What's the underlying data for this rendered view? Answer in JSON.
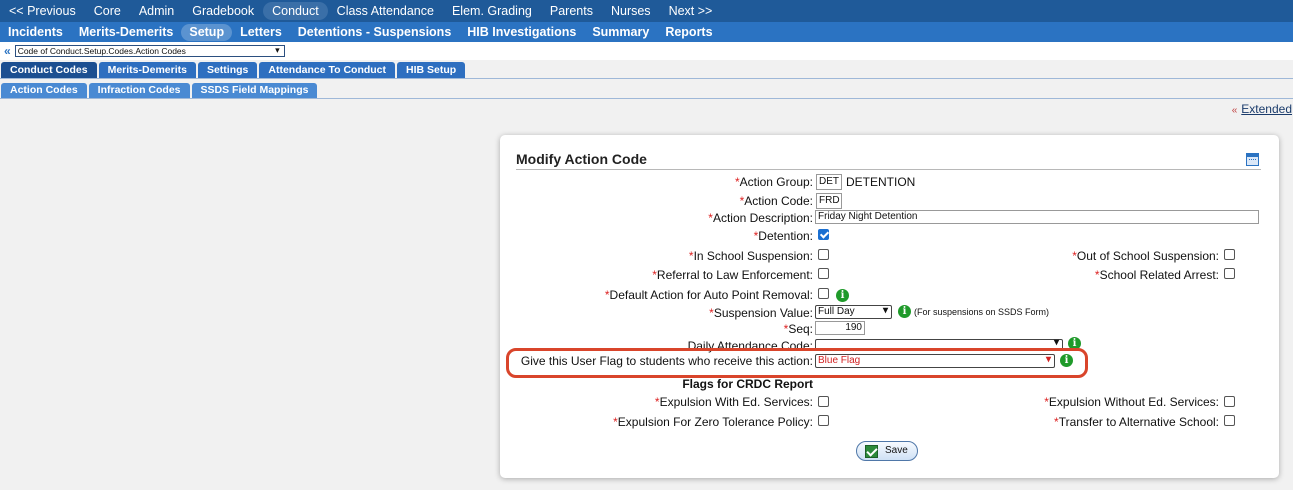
{
  "top_nav": [
    "<< Previous",
    "Core",
    "Admin",
    "Gradebook",
    "Conduct",
    "Class Attendance",
    "Elem. Grading",
    "Parents",
    "Nurses",
    "Next >>"
  ],
  "sub_nav": [
    "Incidents",
    "Merits-Demerits",
    "Setup",
    "Letters",
    "Detentions - Suspensions",
    "HIB Investigations",
    "Summary",
    "Reports"
  ],
  "crumb": {
    "chevron": "«",
    "path": "Code of Conduct.Setup.Codes.Action Codes"
  },
  "tabs1": [
    "Conduct Codes",
    "Merits-Demerits",
    "Settings",
    "Attendance To Conduct",
    "HIB Setup"
  ],
  "tabs2": [
    "Action Codes",
    "Infraction Codes",
    "SSDS Field Mappings"
  ],
  "extended": {
    "arrow": "«",
    "label": "Extended"
  },
  "form": {
    "title": "Modify Action Code",
    "req": "*",
    "action_group_label": "Action Group:",
    "action_group_code": "DET",
    "action_group_name": "DETENTION",
    "action_code_label": "Action Code:",
    "action_code_value": "FRD",
    "action_description_label": "Action Description:",
    "action_description_value": "Friday Night Detention",
    "detention_label": "Detention:",
    "in_school_label": "In School Suspension:",
    "out_school_label": "Out of School Suspension:",
    "referral_label": "Referral to Law Enforcement:",
    "school_arrest_label": "School Related Arrest:",
    "default_action_label": "Default Action for Auto Point Removal:",
    "suspension_value_label": "Suspension Value:",
    "suspension_value": "Full Day",
    "suspension_note": "(For suspensions on SSDS Form)",
    "seq_label": "Seq:",
    "seq_value": "190",
    "daily_attendance_label": "Daily Attendance Code:",
    "daily_attendance_value": "",
    "user_flag_label": "Give this User Flag to students who receive this action:",
    "user_flag_value": "Blue Flag",
    "crdc_heading": "Flags for CRDC Report",
    "expulsion_with_label": "Expulsion With Ed. Services:",
    "expulsion_without_label": "Expulsion Without Ed. Services:",
    "expulsion_zero_label": "Expulsion For Zero Tolerance Policy:",
    "transfer_label": "Transfer to Alternative School:",
    "save_label": "Save",
    "info_glyph": "i",
    "caret": "▾"
  },
  "checked": {
    "detention": true,
    "in_school": false,
    "out_school": false,
    "referral": false,
    "school_arrest": false,
    "default_action": false,
    "expulsion_with": false,
    "expulsion_without": false,
    "expulsion_zero": false,
    "transfer": false
  },
  "colors": {
    "top_nav": "#1f5a99",
    "sub_nav": "#2b73c2",
    "highlight": "#d9452b",
    "info": "#1f9a2a",
    "flag_text": "#d22222"
  }
}
